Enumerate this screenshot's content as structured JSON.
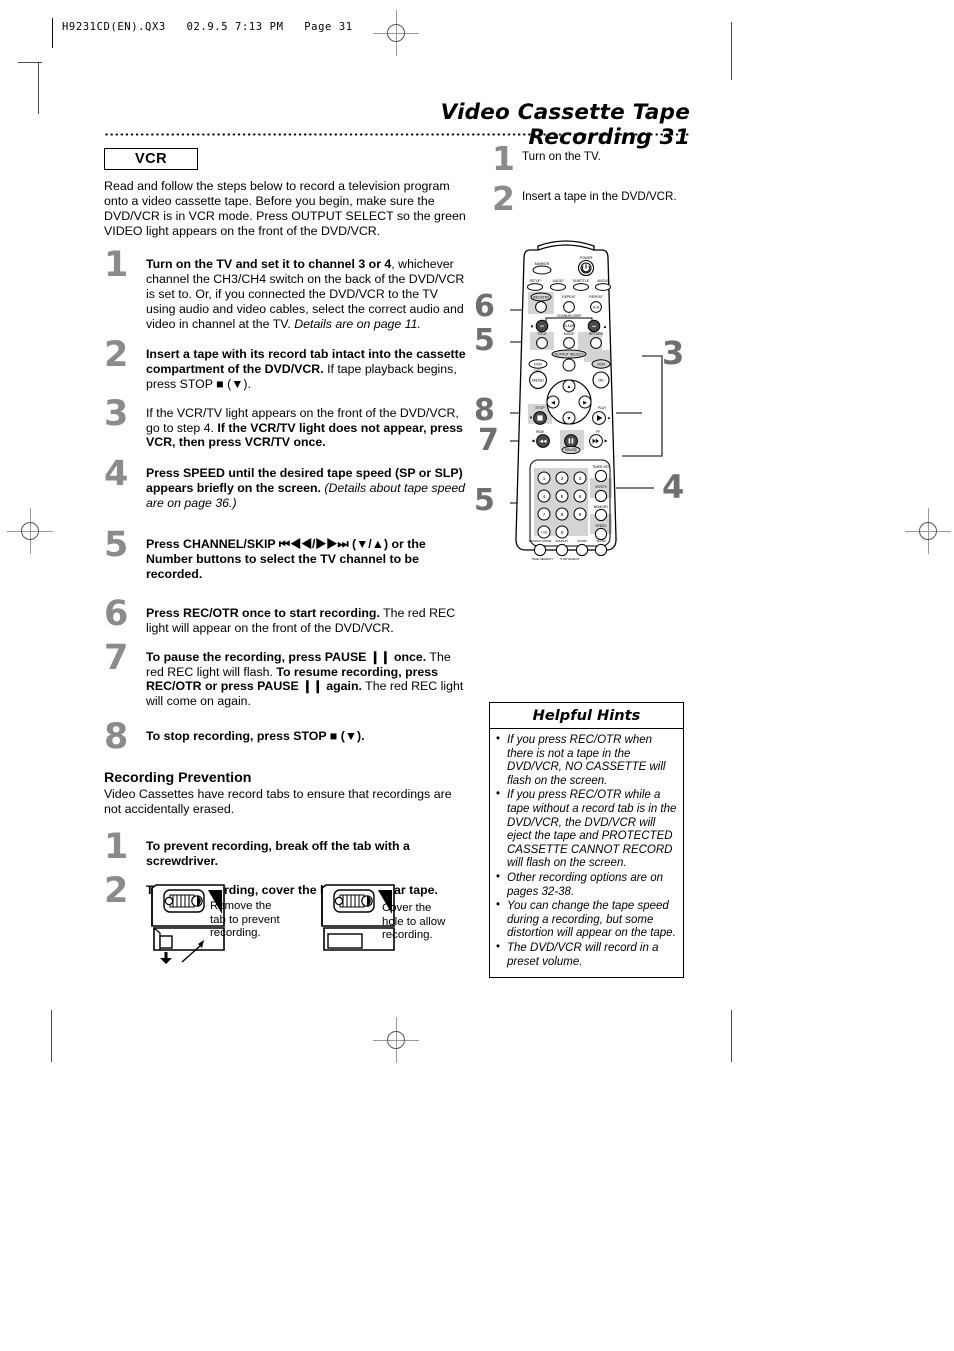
{
  "print_stamp": "H9231CD(EN).QX3   02.9.5 7:13 PM   Page 31",
  "header": {
    "title": "Video Cassette Tape Recording  31"
  },
  "left_column": {
    "mode_tag": "VCR",
    "intro": "Read and follow the steps below to record a television program onto a video cassette tape. Before you begin, make sure the DVD/VCR is in VCR mode. Press OUTPUT SELECT so the green VIDEO light appears on the front of the DVD/VCR.",
    "steps": [
      {
        "num": "1",
        "bold": "Turn on the TV and set it to channel 3 or 4",
        "rest": ", whichever channel the CH3/CH4 switch on the back of the DVD/VCR is set to. Or, if you connected the DVD/VCR to the TV using audio and video cables, select the correct audio and video in channel at the TV. ",
        "italic_tail": "Details are on page 11."
      },
      {
        "num": "2",
        "bold": "Insert a tape with its record tab intact into the cassette compartment of the DVD/VCR.",
        "rest": " If tape playback begins, press STOP ■ (▼).",
        "italic_tail": ""
      },
      {
        "num": "3",
        "bold": "",
        "rest": "If the VCR/TV light appears on the front of the DVD/VCR, go to step 4. ",
        "bold_tail": "If the VCR/TV light does not appear, press VCR, then press VCR/TV once.",
        "italic_tail": ""
      },
      {
        "num": "4",
        "bold": "Press SPEED until the desired tape speed (SP or SLP) appears briefly on the screen.",
        "rest": " ",
        "italic_tail": "(Details about tape speed are on page 36.)"
      },
      {
        "num": "5",
        "bold": "Press CHANNEL/SKIP ⏮◀◀/▶▶⏭ (▼/▲) or the Number buttons to select the TV channel to be recorded.",
        "rest": "",
        "italic_tail": ""
      },
      {
        "num": "6",
        "bold": "Press REC/OTR once to start recording.",
        "rest": " The red REC light will appear on the front of the DVD/VCR.",
        "italic_tail": ""
      },
      {
        "num": "7",
        "bold": "To pause the recording, press PAUSE ❙❙ once.",
        "rest": " The red REC light will flash. ",
        "bold_tail": "To resume recording, press REC/OTR or press PAUSE ❙❙ again.",
        "rest2": " The red REC light will come on again.",
        "italic_tail": ""
      },
      {
        "num": "8",
        "bold": "To stop recording, press STOP ■ (▼).",
        "rest": "",
        "italic_tail": ""
      }
    ],
    "prevention": {
      "heading": "Recording Prevention",
      "body": "Video Cassettes have record tabs to ensure that recordings are not accidentally erased.",
      "steps": [
        {
          "num": "1",
          "text": "To prevent recording, break off the tab with a screwdriver."
        },
        {
          "num": "2",
          "text": "To allow recording, cover the hole with clear tape."
        }
      ],
      "figures": [
        {
          "caption": "Remove the tab to prevent recording."
        },
        {
          "caption": "Cover the hole to allow recording."
        }
      ]
    }
  },
  "right_column": {
    "steps": [
      {
        "num": "1",
        "text": "Turn on the TV."
      },
      {
        "num": "2",
        "text": "Insert a tape in the DVD/VCR."
      }
    ],
    "hints": {
      "title": "Helpful Hints",
      "items": [
        "If you press REC/OTR when there is not a tape in the DVD/VCR, NO CASSETTE will flash on the screen.",
        "If you press REC/OTR while a tape without a record tab is in the DVD/VCR, the DVD/VCR will eject the tape and PROTECTED CASSETTE CANNOT RECORD will flash on the screen.",
        "Other recording options are on pages 32-38.",
        "You can change the tape speed during a recording, but some distortion will appear on the tape.",
        "The DVD/VCR will record in a preset volume."
      ]
    }
  },
  "remote": {
    "callouts": [
      "6",
      "5",
      "3",
      "8",
      "7",
      "5",
      "4"
    ],
    "labels": {
      "marker": "MARKER",
      "power": "POWER",
      "setup": "SETUP",
      "audio": "AUDIO",
      "subtitle": "SUBTITLE",
      "angle": "ANGLE",
      "rec_otr": "REC/OTR",
      "repeat": "REPEAT",
      "repeat_ab": "REPEAT",
      "repeat_ab_btn": "A-B",
      "channel_skip": "CHANNEL/SKIP",
      "title_btn": "TITLE",
      "mode": "MODE",
      "return": "RETURN",
      "clear": "CLEAR",
      "output_select": "OUTPUT SELECT",
      "dvd": "DVD",
      "vcr": "VCR",
      "disc": "DISC",
      "menu": "MENU",
      "ok": "OK",
      "stop": "STOP",
      "play": "PLAY",
      "rew": "REW",
      "pause": "PAUSE",
      "ff": "FF",
      "timer_set": "TIMER SET",
      "vcr_tv": "VCR/TV",
      "memory": "MEMORY",
      "speed": "SPEED",
      "slow": "SLOW",
      "search_mode": "SEARCH MODE",
      "display": "DISPLAY",
      "zoom": "ZOOM",
      "time_search": "TIME SEARCH",
      "status_exit": "STATUS/EXIT"
    },
    "keypad": [
      "1",
      "2",
      "3",
      "4",
      "5",
      "6",
      "7",
      "8",
      "9",
      "+10",
      "0"
    ]
  },
  "colors": {
    "step_number_gray": "#8b8b8b",
    "highlight_gray": "#d4d4d4",
    "ink": "#000000"
  }
}
